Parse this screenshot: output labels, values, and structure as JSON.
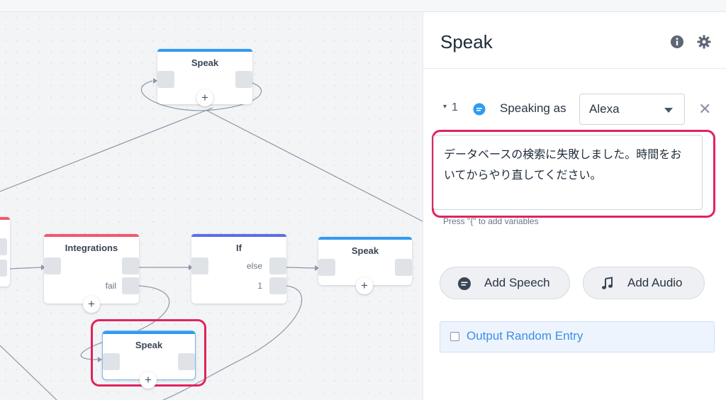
{
  "canvas": {
    "nodes": {
      "speak_top": {
        "title": "Speak"
      },
      "integrations": {
        "title": "Integrations",
        "fail_label": "fail"
      },
      "if_node": {
        "title": "If",
        "else_label": "else",
        "one_label": "1"
      },
      "speak_right": {
        "title": "Speak"
      },
      "speak_selected": {
        "title": "Speak"
      }
    },
    "add_symbol": "+"
  },
  "panel": {
    "title": "Speak",
    "info_icon": "info-icon",
    "settings_icon": "gear-icon",
    "entry": {
      "caret": "▾",
      "index": "1",
      "speaking_as_label": "Speaking as",
      "voice_value": "Alexa",
      "close_symbol": "✕",
      "text": "データベースの検索に失敗しました。時間をおいてからやり直してください。",
      "hint": "Press \"{\" to add variables"
    },
    "buttons": {
      "add_speech": "Add Speech",
      "add_audio": "Add Audio"
    },
    "random_label": "Output Random Entry"
  },
  "colors": {
    "accent_blue": "#2f9bf0",
    "integrations_red": "#ef5a6f",
    "if_indigo": "#5a6ee8",
    "highlight": "#e0245e",
    "link_blue": "#3b8ee8"
  }
}
